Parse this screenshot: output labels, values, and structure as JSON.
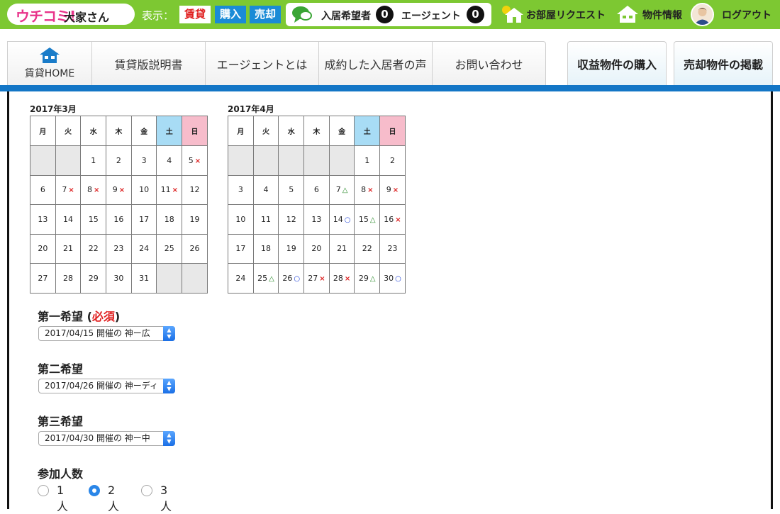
{
  "header": {
    "logo": "ウチコミ!",
    "logo_sub": "大家さん",
    "display_label": "表示：",
    "modes": [
      "賃貸",
      "購入",
      "売却"
    ],
    "applicants_label": "入居希望者",
    "applicants_count": "0",
    "agents_label": "エージェント",
    "agents_count": "0",
    "room_request": "お部屋リクエスト",
    "property_info": "物件情報",
    "logout": "ログアウト"
  },
  "tabs": {
    "home": "賃貸HOME",
    "manual": "賃貸版説明書",
    "agent": "エージェントとは",
    "voices": "成約した入居者の声",
    "contact": "お問い合わせ",
    "buy_income": "収益物件の購入",
    "sell_listing": "売却物件の掲載"
  },
  "calendars": [
    {
      "title": "2017年3月",
      "weekdays": [
        "月",
        "火",
        "水",
        "木",
        "金",
        "土",
        "日"
      ],
      "weeks": [
        [
          {
            "d": ""
          },
          {
            "d": ""
          },
          {
            "d": "1"
          },
          {
            "d": "2"
          },
          {
            "d": "3"
          },
          {
            "d": "4"
          },
          {
            "d": "5",
            "m": "×"
          }
        ],
        [
          {
            "d": "6"
          },
          {
            "d": "7",
            "m": "×"
          },
          {
            "d": "8",
            "m": "×"
          },
          {
            "d": "9",
            "m": "×"
          },
          {
            "d": "10"
          },
          {
            "d": "11",
            "m": "×"
          },
          {
            "d": "12"
          }
        ],
        [
          {
            "d": "13"
          },
          {
            "d": "14"
          },
          {
            "d": "15"
          },
          {
            "d": "16"
          },
          {
            "d": "17"
          },
          {
            "d": "18"
          },
          {
            "d": "19"
          }
        ],
        [
          {
            "d": "20"
          },
          {
            "d": "21"
          },
          {
            "d": "22"
          },
          {
            "d": "23"
          },
          {
            "d": "24"
          },
          {
            "d": "25"
          },
          {
            "d": "26"
          }
        ],
        [
          {
            "d": "27"
          },
          {
            "d": "28"
          },
          {
            "d": "29"
          },
          {
            "d": "30"
          },
          {
            "d": "31"
          },
          {
            "d": ""
          },
          {
            "d": ""
          }
        ]
      ]
    },
    {
      "title": "2017年4月",
      "weekdays": [
        "月",
        "火",
        "水",
        "木",
        "金",
        "土",
        "日"
      ],
      "weeks": [
        [
          {
            "d": ""
          },
          {
            "d": ""
          },
          {
            "d": ""
          },
          {
            "d": ""
          },
          {
            "d": ""
          },
          {
            "d": "1"
          },
          {
            "d": "2"
          }
        ],
        [
          {
            "d": "3"
          },
          {
            "d": "4"
          },
          {
            "d": "5"
          },
          {
            "d": "6"
          },
          {
            "d": "7",
            "m": "△"
          },
          {
            "d": "8",
            "m": "×"
          },
          {
            "d": "9",
            "m": "×"
          }
        ],
        [
          {
            "d": "10"
          },
          {
            "d": "11"
          },
          {
            "d": "12"
          },
          {
            "d": "13"
          },
          {
            "d": "14",
            "m": "○"
          },
          {
            "d": "15",
            "m": "△"
          },
          {
            "d": "16",
            "m": "×"
          }
        ],
        [
          {
            "d": "17"
          },
          {
            "d": "18"
          },
          {
            "d": "19"
          },
          {
            "d": "20"
          },
          {
            "d": "21"
          },
          {
            "d": "22"
          },
          {
            "d": "23"
          }
        ],
        [
          {
            "d": "24"
          },
          {
            "d": "25",
            "m": "△"
          },
          {
            "d": "26",
            "m": "○"
          },
          {
            "d": "27",
            "m": "×"
          },
          {
            "d": "28",
            "m": "×"
          },
          {
            "d": "29",
            "m": "△"
          },
          {
            "d": "30",
            "m": "○"
          }
        ]
      ]
    }
  ],
  "form": {
    "first_label": "第一希望 (",
    "first_required": "必須",
    "first_close": ")",
    "first_value": "2017/04/15 開催の 神ー広",
    "second_label": "第二希望",
    "second_value": "2017/04/26 開催の 神ーディ",
    "third_label": "第三希望",
    "third_value": "2017/04/30 開催の 神ー中",
    "people_label": "参加人数",
    "people_options": [
      "1人",
      "2人",
      "3人"
    ],
    "people_selected": "2人"
  },
  "colors": {
    "topbar": "#7dc832",
    "accent_blue": "#1376c6",
    "mark_x": "#dd2222",
    "mark_triangle": "#2a8a2a",
    "mark_circle": "#1b3fd6"
  }
}
